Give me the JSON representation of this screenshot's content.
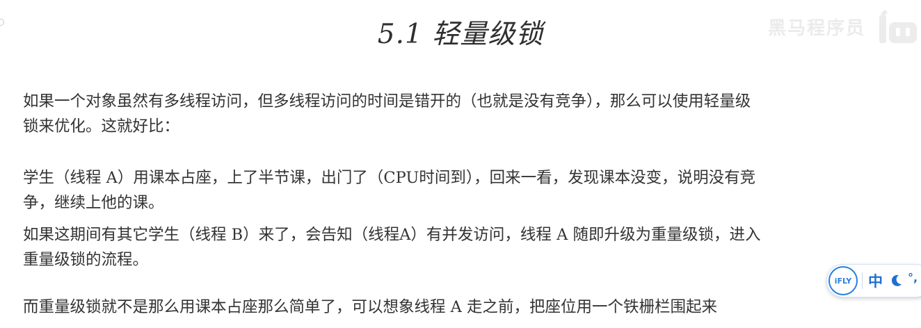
{
  "title": "5.1 轻量级锁",
  "watermark": {
    "text": "黑马程序员",
    "logo_icon": "bilibili-logo-icon"
  },
  "paragraphs": {
    "p1": {
      "line1": "如果一个对象虽然有多线程访问，但多线程访问的时间是错开的（也就是没有竞争），那么可以使用轻量级",
      "line2": "锁来优化。这就好比："
    },
    "p2": {
      "line1": "学生（线程 A）用课本占座，上了半节课，出门了（CPU时间到），回来一看，发现课本没变，说明没有竞",
      "line2": "争，继续上他的课。"
    },
    "p3": {
      "line1": "如果这期间有其它学生（线程 B）来了，会告知（线程A）有并发访问，线程 A 随即升级为重量级锁，进入",
      "line2": "重量级锁的流程。"
    },
    "p4": {
      "line1": "而重量级锁就不是那么用课本占座那么简单了，可以想象线程 A 走之前，把座位用一个铁栅栏围起来"
    }
  },
  "ime": {
    "logo_text": "iFLY",
    "lang_label": "中",
    "mode_icon": "moon-icon",
    "punct_label": "°,",
    "accent_color": "#1f6fd0"
  }
}
